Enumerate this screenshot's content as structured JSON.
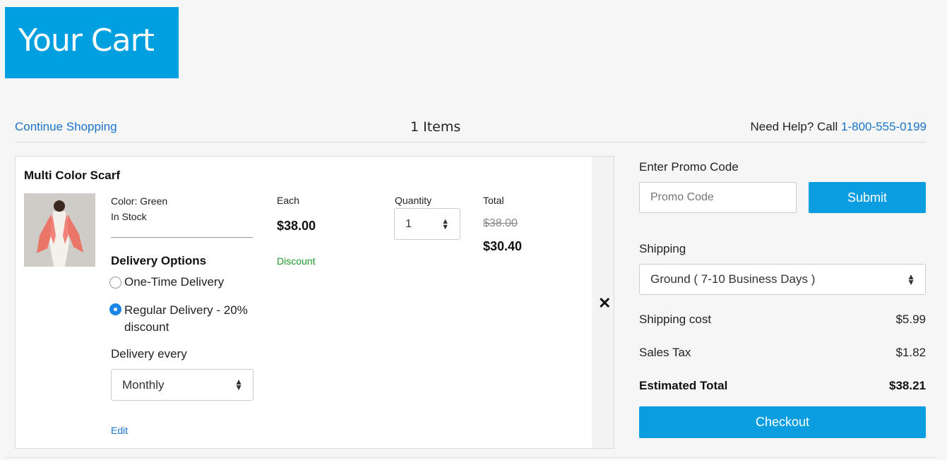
{
  "header": {
    "title": "Your Cart"
  },
  "topbar": {
    "continue_label": "Continue Shopping",
    "items_count": "1 Items",
    "help_prefix": "Need Help? Call ",
    "help_phone": "1-800-555-0199"
  },
  "item": {
    "name": "Multi Color Scarf",
    "color": "Color: Green",
    "stock": "In Stock",
    "each_label": "Each",
    "each_price": "$38.00",
    "discount_label": "Discount",
    "quantity_label": "Quantity",
    "quantity_value": "1",
    "total_label": "Total",
    "original_total": "$38.00",
    "discounted_total": "$30.40",
    "remove_symbol": "✕",
    "delivery": {
      "title": "Delivery Options",
      "one_time_label": "One-Time Delivery",
      "regular_label": "Regular Delivery - 20% discount",
      "selected": "regular",
      "every_label": "Delivery every",
      "frequency_value": "Monthly",
      "edit_label": "Edit"
    }
  },
  "summary": {
    "promo_label": "Enter Promo Code",
    "promo_placeholder": "Promo Code",
    "submit_label": "Submit",
    "shipping_label": "Shipping",
    "shipping_method": "Ground ( 7-10 Business Days )",
    "shipping_cost_label": "Shipping cost",
    "shipping_cost": "$5.99",
    "sales_tax_label": "Sales Tax",
    "sales_tax": "$1.82",
    "estimated_total_label": "Estimated Total",
    "estimated_total": "$38.21",
    "checkout_label": "Checkout"
  },
  "colors": {
    "brand": "#009fe0",
    "button": "#0a9de0",
    "link": "#1a73c9",
    "discount": "#1f9a2c"
  }
}
